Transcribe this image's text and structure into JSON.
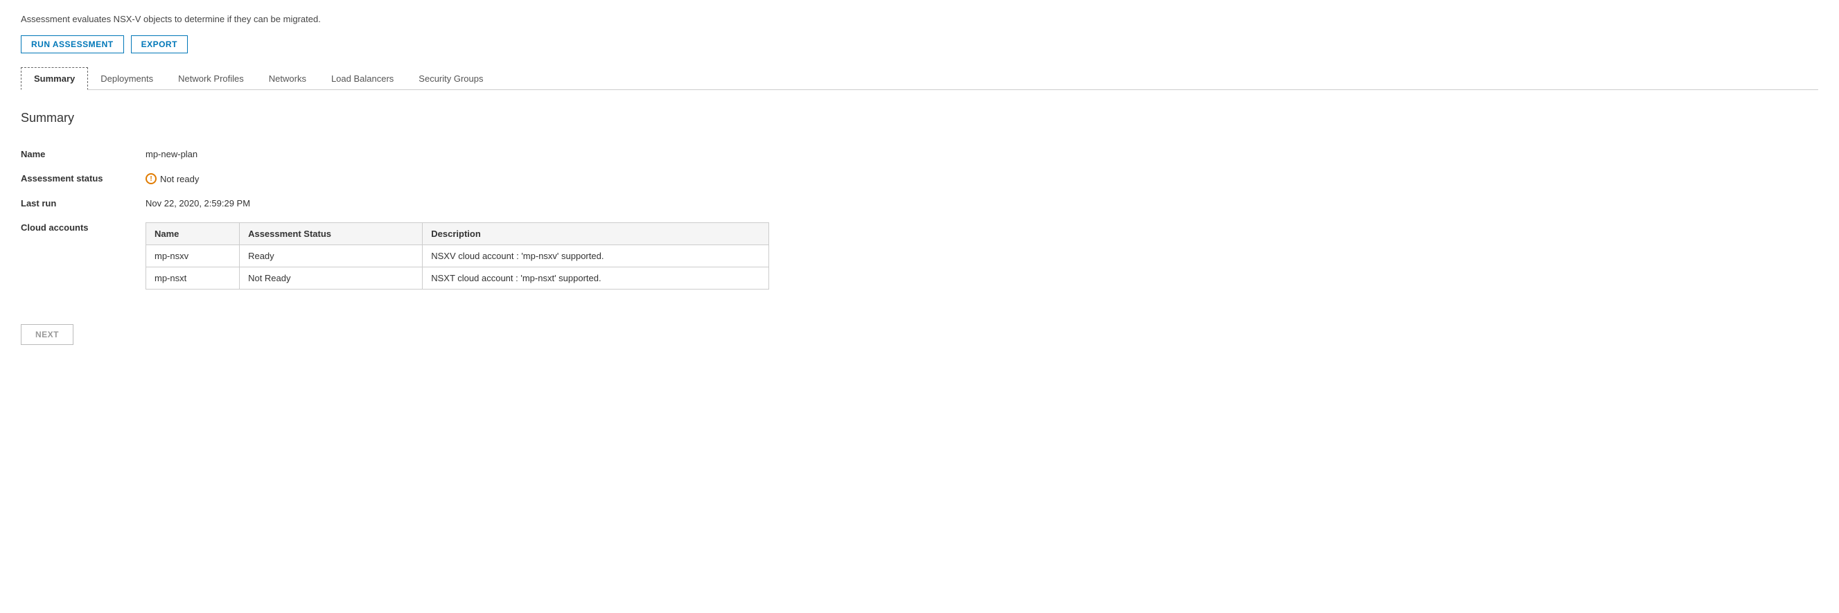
{
  "description": "Assessment evaluates NSX-V objects to determine if they can be migrated.",
  "toolbar": {
    "run_assessment_label": "RUN ASSESSMENT",
    "export_label": "EXPORT"
  },
  "tabs": [
    {
      "label": "Summary",
      "active": true
    },
    {
      "label": "Deployments",
      "active": false
    },
    {
      "label": "Network Profiles",
      "active": false
    },
    {
      "label": "Networks",
      "active": false
    },
    {
      "label": "Load Balancers",
      "active": false
    },
    {
      "label": "Security Groups",
      "active": false
    }
  ],
  "content": {
    "title": "Summary",
    "fields": {
      "name_label": "Name",
      "name_value": "mp-new-plan",
      "assessment_status_label": "Assessment status",
      "assessment_status_value": "Not ready",
      "last_run_label": "Last run",
      "last_run_value": "Nov 22, 2020, 2:59:29 PM",
      "cloud_accounts_label": "Cloud accounts"
    },
    "cloud_accounts_table": {
      "headers": [
        "Name",
        "Assessment Status",
        "Description"
      ],
      "rows": [
        {
          "name": "mp-nsxv",
          "status": "Ready",
          "description": "NSXV cloud account : 'mp-nsxv' supported."
        },
        {
          "name": "mp-nsxt",
          "status": "Not Ready",
          "description": "NSXT cloud account : 'mp-nsxt' supported."
        }
      ]
    }
  },
  "footer": {
    "next_label": "NEXT"
  }
}
